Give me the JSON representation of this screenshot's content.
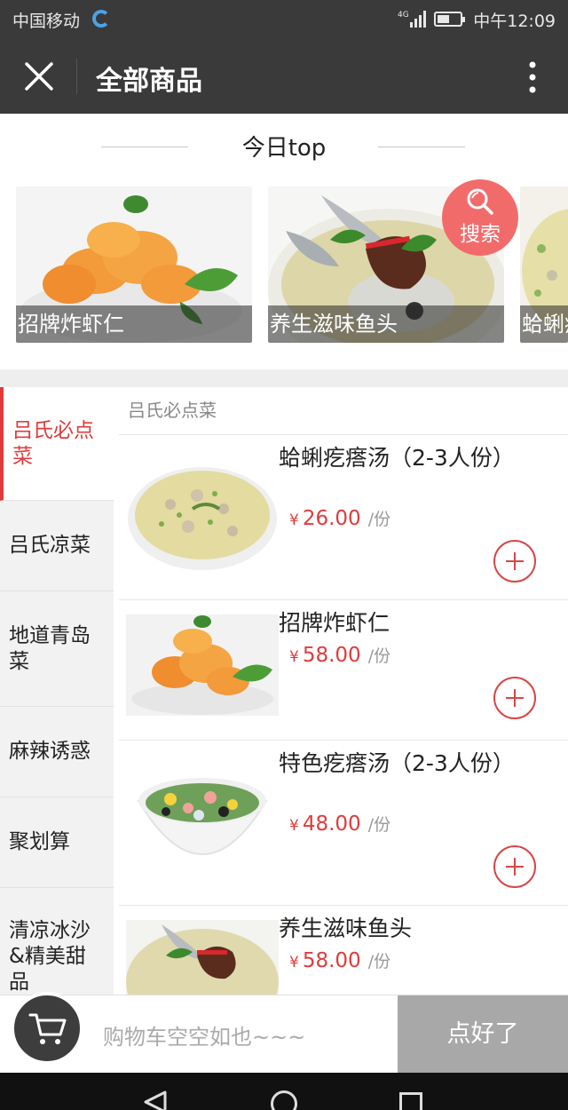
{
  "status_bar": {
    "carrier": "中国移动",
    "network": "4G",
    "time": "中午12:09",
    "battery_level": 0.55
  },
  "title_bar": {
    "title": "全部商品"
  },
  "top_section": {
    "heading": "今日top",
    "cards": [
      {
        "caption": "招牌炸虾仁"
      },
      {
        "caption": "养生滋味鱼头"
      },
      {
        "caption": "蛤蜊疙"
      }
    ],
    "search_label": "搜索"
  },
  "sidebar": {
    "categories": [
      {
        "label": "吕氏必点菜"
      },
      {
        "label": "吕氏凉菜"
      },
      {
        "label": "地道青岛菜"
      },
      {
        "label": "麻辣诱惑"
      },
      {
        "label": "聚划算"
      },
      {
        "label": "清凉冰沙&精美甜品"
      }
    ]
  },
  "product_list": {
    "header": "吕氏必点菜",
    "items": [
      {
        "name": "蛤蜊疙瘩汤（2-3人份）",
        "currency": "¥",
        "price": "26.00",
        "unit": "/份"
      },
      {
        "name": "招牌炸虾仁",
        "currency": "¥",
        "price": "58.00",
        "unit": "/份"
      },
      {
        "name": "特色疙瘩汤（2-3人份）",
        "currency": "¥",
        "price": "48.00",
        "unit": "/份"
      },
      {
        "name": "养生滋味鱼头",
        "currency": "¥",
        "price": "58.00",
        "unit": "/份"
      }
    ]
  },
  "cart_bar": {
    "empty_text": "购物车空空如也~~~",
    "checkout_label": "点好了"
  },
  "colors": {
    "accent": "#e03b3b",
    "header_bg": "#3a3a3a",
    "search_fab": "#f26b6b",
    "checkout_bg": "#a8a8a8"
  }
}
